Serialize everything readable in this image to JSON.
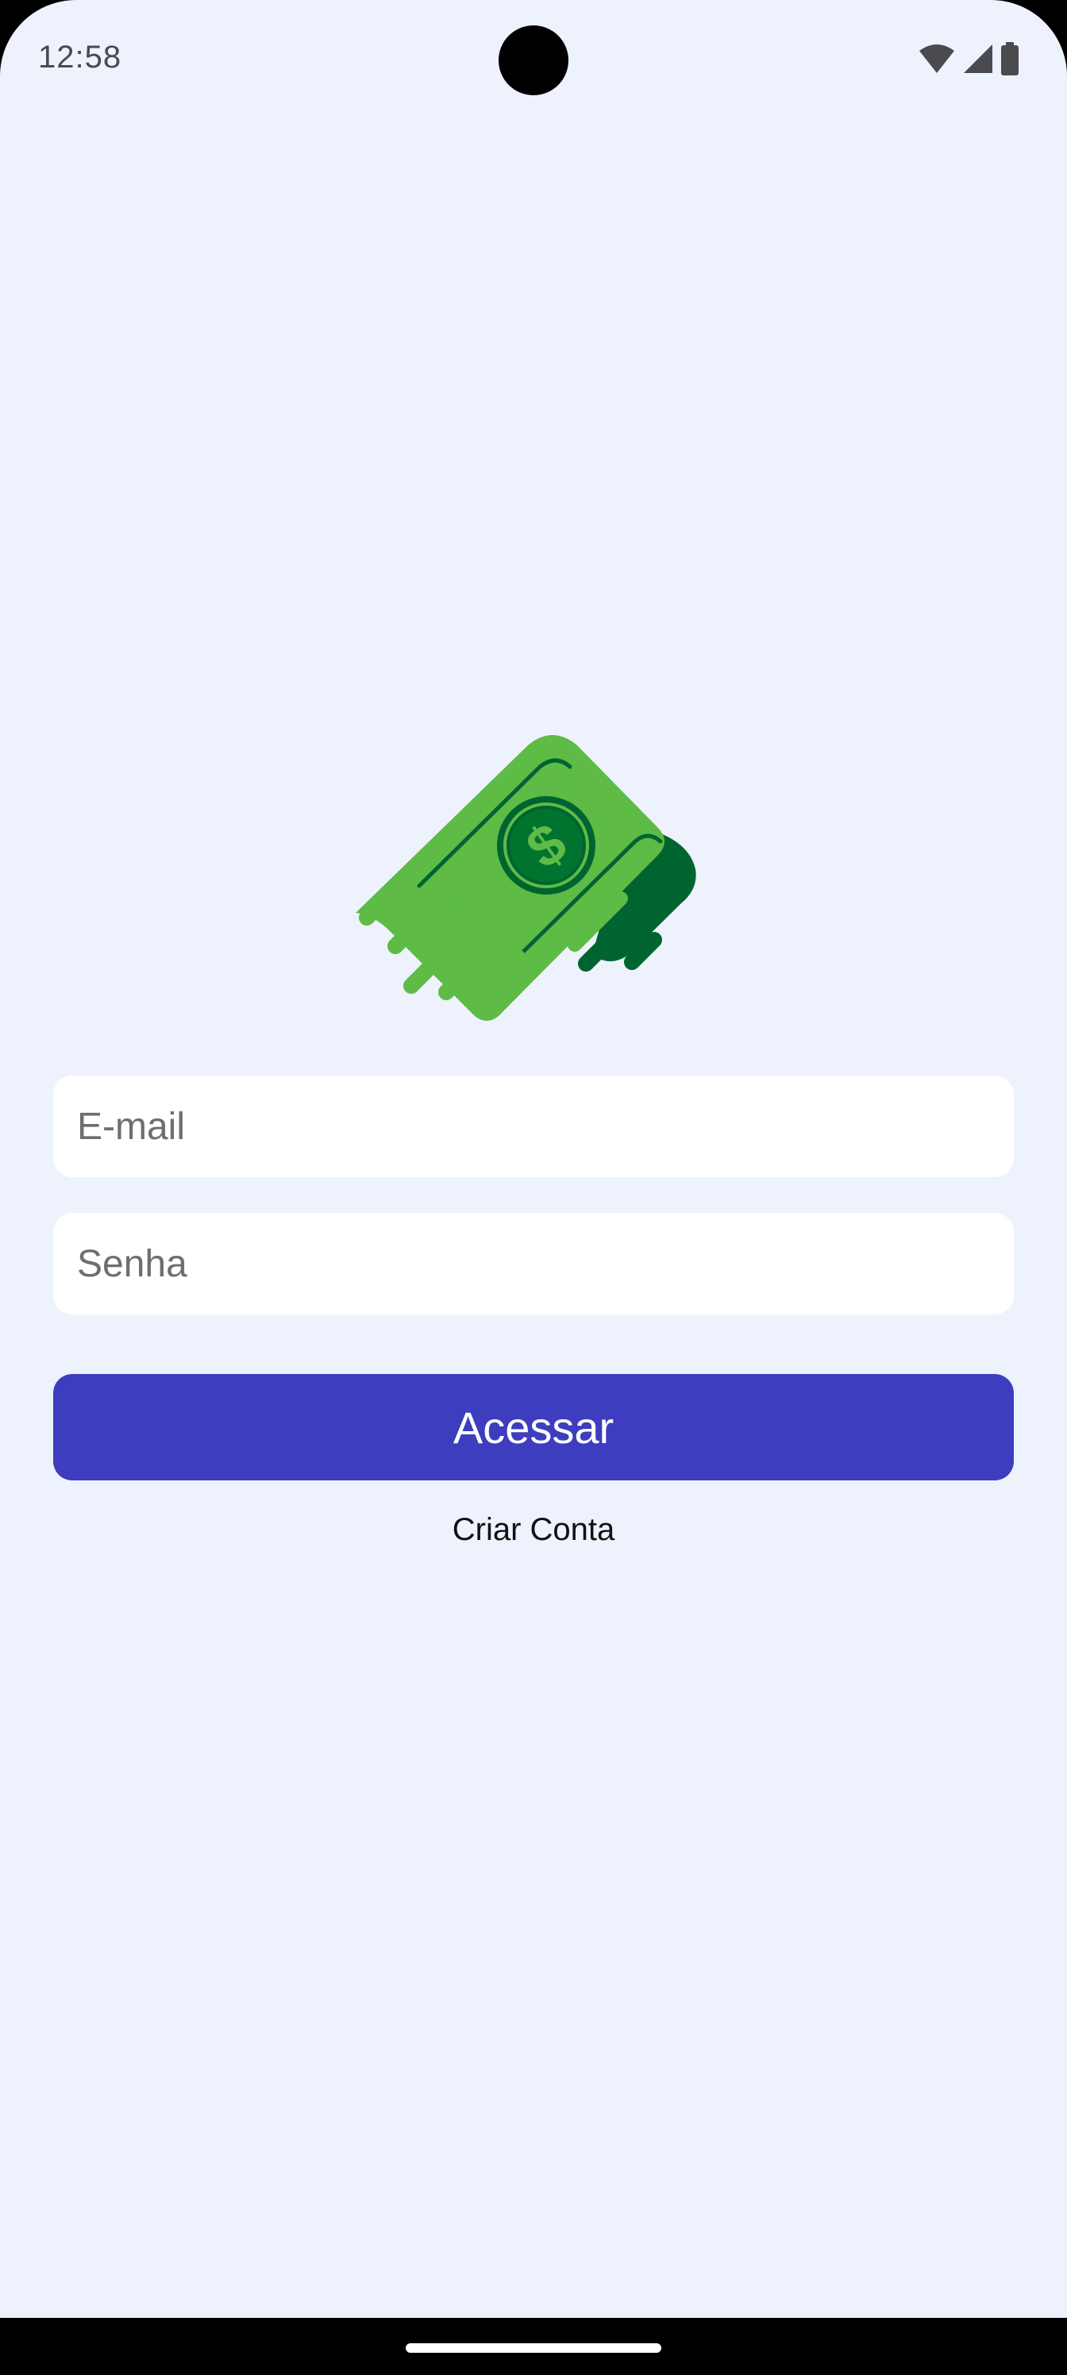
{
  "status_bar": {
    "time": "12:58",
    "icons": [
      "wifi-icon",
      "cell-signal-icon",
      "battery-icon"
    ]
  },
  "logo": {
    "icon": "flying-money-icon",
    "symbol": "$",
    "colors": {
      "bill_light": "#5dbb46",
      "bill_dark": "#006430",
      "coin": "#00732f"
    }
  },
  "form": {
    "email_placeholder": "E-mail",
    "email_value": "",
    "password_placeholder": "Senha",
    "password_value": "",
    "submit_label": "Acessar",
    "create_account_label": "Criar Conta"
  },
  "colors": {
    "background": "#eef2fd",
    "primary": "#3d3dc0",
    "field_background": "#ffffff"
  }
}
